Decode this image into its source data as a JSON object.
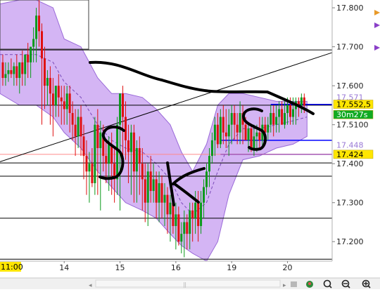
{
  "chart_data": {
    "type": "candlestick",
    "title": "",
    "xlabel": "",
    "ylabel": "",
    "ylim": [
      17.15,
      17.82
    ],
    "x_ticks": [
      {
        "label": "11:00",
        "x": 0.0
      },
      {
        "label": "14",
        "x": 1.0
      },
      {
        "label": "15",
        "x": 2.0
      },
      {
        "label": "16",
        "x": 3.0
      },
      {
        "label": "19",
        "x": 4.0
      },
      {
        "label": "20",
        "x": 5.0
      }
    ],
    "xlim": [
      -0.15,
      5.8
    ],
    "y_ticks": [
      17.8,
      17.7,
      17.6,
      17.5,
      17.4,
      17.3,
      17.2
    ],
    "y_tick_labels": [
      "17.800",
      "17.700",
      "17.600",
      "17.5100",
      "17.400",
      "17.300",
      "17.200"
    ],
    "price_tags": [
      {
        "label": "17.571",
        "value": 17.571,
        "color": "#ffffff",
        "text_color": "#9a7ad6"
      },
      {
        "label": "17.552,5",
        "value": 17.5525,
        "color": "#ffe600",
        "text_color": "#000000"
      },
      {
        "label": "30m27s",
        "value": 17.526,
        "color": "#11aa22",
        "text_color": "#ffffff"
      },
      {
        "label": "17.448",
        "value": 17.448,
        "color": "#ffffff",
        "text_color": "#9a7ad6"
      },
      {
        "label": "17.424",
        "value": 17.424,
        "color": "#ffe600",
        "text_color": "#000000"
      }
    ],
    "horizontal_levels": [
      {
        "value": 17.692,
        "color": "#000000"
      },
      {
        "value": 17.55,
        "color": "#000000"
      },
      {
        "value": 17.552,
        "color": "#0000ff"
      },
      {
        "value": 17.46,
        "color": "#0000ff"
      },
      {
        "value": 17.424,
        "color": "#0000ff"
      },
      {
        "value": 17.424,
        "color": "#ff8a8a"
      },
      {
        "value": 17.402,
        "color": "#000000"
      },
      {
        "value": 17.368,
        "color": "#000000"
      },
      {
        "value": 17.26,
        "color": "#000000"
      },
      {
        "value": 17.155,
        "color": "#000000"
      }
    ],
    "trendline": {
      "x": [
        -0.15,
        5.8
      ],
      "y": [
        17.405,
        17.685
      ],
      "color": "#000000"
    },
    "bollinger_bands": {
      "color": "#c59cf0",
      "x": [
        -0.15,
        0.2,
        0.5,
        0.8,
        1.0,
        1.3,
        1.6,
        1.85,
        2.1,
        2.4,
        2.65,
        2.9,
        3.1,
        3.3,
        3.55,
        3.75,
        3.95,
        4.2,
        4.5,
        4.8,
        5.1,
        5.35
      ],
      "upper": [
        17.81,
        17.82,
        17.82,
        17.8,
        17.72,
        17.7,
        17.62,
        17.58,
        17.58,
        17.57,
        17.54,
        17.5,
        17.43,
        17.38,
        17.45,
        17.55,
        17.58,
        17.58,
        17.57,
        17.56,
        17.56,
        17.56
      ],
      "lower": [
        17.58,
        17.55,
        17.55,
        17.52,
        17.48,
        17.44,
        17.38,
        17.34,
        17.3,
        17.28,
        17.26,
        17.22,
        17.19,
        17.17,
        17.15,
        17.2,
        17.32,
        17.41,
        17.42,
        17.44,
        17.45,
        17.47
      ],
      "middle": [
        17.68,
        17.68,
        17.68,
        17.66,
        17.61,
        17.57,
        17.5,
        17.46,
        17.44,
        17.43,
        17.4,
        17.36,
        17.3,
        17.27,
        17.3,
        17.38,
        17.45,
        17.49,
        17.49,
        17.5,
        17.51,
        17.52
      ]
    },
    "series": [
      {
        "x": [
          -0.1,
          -0.05,
          0.0,
          0.05,
          0.1,
          0.15,
          0.2,
          0.25,
          0.3,
          0.35,
          0.4,
          0.45,
          0.5,
          0.55,
          0.6,
          0.65,
          0.7,
          0.75,
          0.8,
          0.85,
          0.9,
          0.95,
          1.0,
          1.05,
          1.1,
          1.15,
          1.2,
          1.25,
          1.3,
          1.35,
          1.4,
          1.45,
          1.5,
          1.55,
          1.6,
          1.65,
          1.7,
          1.75,
          1.8,
          1.85,
          1.9,
          1.95,
          2.0,
          2.05,
          2.1,
          2.15,
          2.2,
          2.25,
          2.3,
          2.35,
          2.4,
          2.45,
          2.5,
          2.55,
          2.6,
          2.65,
          2.7,
          2.75,
          2.8,
          2.85,
          2.9,
          2.95,
          3.0,
          3.05,
          3.1,
          3.15,
          3.2,
          3.25,
          3.3,
          3.35,
          3.4,
          3.45,
          3.5,
          3.55,
          3.6,
          3.65,
          3.7,
          3.75,
          3.8,
          3.85,
          3.9,
          3.95,
          4.0,
          4.05,
          4.1,
          4.15,
          4.2,
          4.25,
          4.3,
          4.35,
          4.4,
          4.45,
          4.5,
          4.55,
          4.6,
          4.65,
          4.7,
          4.75,
          4.8,
          4.85,
          4.9,
          4.95,
          5.0,
          5.05,
          5.1,
          5.15,
          5.2,
          5.25,
          5.3
        ],
        "open": [
          17.66,
          17.62,
          17.63,
          17.64,
          17.63,
          17.65,
          17.62,
          17.66,
          17.63,
          17.68,
          17.66,
          17.7,
          17.72,
          17.78,
          17.74,
          17.67,
          17.6,
          17.62,
          17.58,
          17.55,
          17.6,
          17.57,
          17.56,
          17.54,
          17.58,
          17.53,
          17.5,
          17.47,
          17.52,
          17.47,
          17.42,
          17.38,
          17.4,
          17.35,
          17.5,
          17.44,
          17.48,
          17.42,
          17.4,
          17.45,
          17.4,
          17.36,
          17.5,
          17.58,
          17.52,
          17.46,
          17.43,
          17.48,
          17.38,
          17.44,
          17.4,
          17.36,
          17.3,
          17.38,
          17.33,
          17.36,
          17.3,
          17.35,
          17.3,
          17.32,
          17.27,
          17.3,
          17.24,
          17.27,
          17.2,
          17.22,
          17.25,
          17.22,
          17.28,
          17.26,
          17.3,
          17.24,
          17.3,
          17.34,
          17.38,
          17.42,
          17.46,
          17.5,
          17.45,
          17.52,
          17.48,
          17.47,
          17.5,
          17.53,
          17.5,
          17.48,
          17.53,
          17.5,
          17.46,
          17.49,
          17.44,
          17.47,
          17.48,
          17.46,
          17.5,
          17.48,
          17.5,
          17.53,
          17.5,
          17.52,
          17.54,
          17.5,
          17.53,
          17.55,
          17.52,
          17.54,
          17.56,
          17.55,
          17.57
        ],
        "high": [
          17.68,
          17.66,
          17.66,
          17.67,
          17.66,
          17.68,
          17.66,
          17.69,
          17.67,
          17.71,
          17.7,
          17.75,
          17.8,
          17.82,
          17.76,
          17.7,
          17.64,
          17.65,
          17.62,
          17.6,
          17.63,
          17.6,
          17.6,
          17.6,
          17.6,
          17.56,
          17.54,
          17.54,
          17.55,
          17.5,
          17.46,
          17.43,
          17.44,
          17.52,
          17.54,
          17.51,
          17.5,
          17.46,
          17.47,
          17.48,
          17.44,
          17.52,
          17.58,
          17.6,
          17.56,
          17.5,
          17.5,
          17.5,
          17.46,
          17.47,
          17.44,
          17.4,
          17.4,
          17.42,
          17.4,
          17.38,
          17.38,
          17.37,
          17.35,
          17.34,
          17.32,
          17.32,
          17.3,
          17.29,
          17.25,
          17.28,
          17.27,
          17.3,
          17.3,
          17.33,
          17.33,
          17.33,
          17.36,
          17.4,
          17.44,
          17.48,
          17.52,
          17.53,
          17.54,
          17.55,
          17.54,
          17.54,
          17.55,
          17.55,
          17.53,
          17.56,
          17.55,
          17.52,
          17.5,
          17.5,
          17.5,
          17.5,
          17.52,
          17.52,
          17.52,
          17.52,
          17.55,
          17.55,
          17.55,
          17.56,
          17.56,
          17.56,
          17.57,
          17.57,
          17.57,
          17.57,
          17.57,
          17.58,
          17.58
        ],
        "low": [
          17.6,
          17.6,
          17.61,
          17.62,
          17.6,
          17.6,
          17.58,
          17.6,
          17.6,
          17.62,
          17.62,
          17.66,
          17.66,
          17.7,
          17.5,
          17.54,
          17.55,
          17.5,
          17.47,
          17.52,
          17.52,
          17.5,
          17.5,
          17.5,
          17.48,
          17.46,
          17.42,
          17.44,
          17.42,
          17.36,
          17.32,
          17.3,
          17.34,
          17.32,
          17.32,
          17.28,
          17.38,
          17.35,
          17.33,
          17.32,
          17.3,
          17.32,
          17.28,
          17.42,
          17.41,
          17.35,
          17.32,
          17.3,
          17.3,
          17.32,
          17.28,
          17.25,
          17.24,
          17.3,
          17.3,
          17.26,
          17.25,
          17.26,
          17.24,
          17.22,
          17.2,
          17.22,
          17.18,
          17.19,
          17.17,
          17.16,
          17.18,
          17.18,
          17.2,
          17.22,
          17.2,
          17.22,
          17.26,
          17.32,
          17.34,
          17.4,
          17.42,
          17.44,
          17.44,
          17.45,
          17.44,
          17.42,
          17.45,
          17.46,
          17.45,
          17.45,
          17.45,
          17.46,
          17.43,
          17.43,
          17.42,
          17.43,
          17.44,
          17.44,
          17.45,
          17.46,
          17.48,
          17.47,
          17.48,
          17.48,
          17.5,
          17.49,
          17.5,
          17.5,
          17.5,
          17.5,
          17.52,
          17.53,
          17.53
        ],
        "close": [
          17.62,
          17.63,
          17.64,
          17.63,
          17.65,
          17.62,
          17.66,
          17.63,
          17.68,
          17.66,
          17.7,
          17.72,
          17.78,
          17.74,
          17.67,
          17.6,
          17.62,
          17.58,
          17.55,
          17.6,
          17.57,
          17.56,
          17.54,
          17.58,
          17.53,
          17.5,
          17.47,
          17.52,
          17.47,
          17.42,
          17.38,
          17.4,
          17.35,
          17.5,
          17.44,
          17.48,
          17.42,
          17.4,
          17.45,
          17.4,
          17.36,
          17.5,
          17.58,
          17.52,
          17.46,
          17.43,
          17.48,
          17.38,
          17.44,
          17.4,
          17.36,
          17.3,
          17.38,
          17.33,
          17.36,
          17.3,
          17.35,
          17.3,
          17.32,
          17.27,
          17.3,
          17.24,
          17.27,
          17.2,
          17.22,
          17.25,
          17.22,
          17.28,
          17.26,
          17.3,
          17.24,
          17.3,
          17.34,
          17.38,
          17.42,
          17.46,
          17.5,
          17.45,
          17.52,
          17.48,
          17.47,
          17.5,
          17.53,
          17.5,
          17.48,
          17.53,
          17.5,
          17.46,
          17.49,
          17.44,
          17.47,
          17.48,
          17.46,
          17.5,
          17.48,
          17.5,
          17.53,
          17.5,
          17.52,
          17.54,
          17.5,
          17.53,
          17.55,
          17.52,
          17.54,
          17.56,
          17.55,
          17.57,
          17.55
        ]
      }
    ],
    "colors": {
      "up": "#0a9a1a",
      "down": "#e01010",
      "band": "#c59cf0",
      "annotation": "#000000"
    }
  },
  "toolbar": {
    "icons": [
      "chevron-left-icon",
      "scroll-thumb-icon",
      "chevron-right-icon",
      "print-icon",
      "robot-icon",
      "zoom-fit-icon",
      "zoom-out-icon",
      "zoom-in-icon"
    ]
  },
  "annotations": {
    "letters": [
      "S",
      "K",
      "S"
    ]
  }
}
